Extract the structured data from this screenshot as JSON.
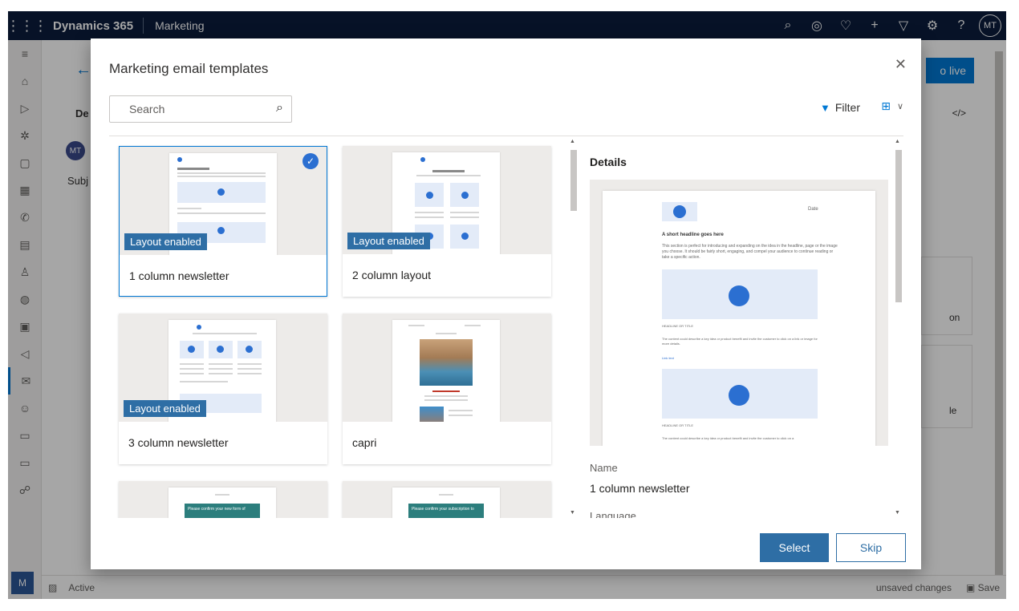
{
  "topbar": {
    "brand": "Dynamics 365",
    "app": "Marketing",
    "avatar": "MT",
    "icons": [
      "search-icon",
      "target-icon",
      "lightbulb-icon",
      "plus-icon",
      "filter-icon",
      "gear-icon",
      "help-icon"
    ]
  },
  "background": {
    "go_live": "o live",
    "tab": "De",
    "code": "</>",
    "avatar": "MT",
    "subject": "Subj",
    "card1_text": "on",
    "card2_text": "le",
    "status": "Active",
    "unsaved": "unsaved changes",
    "save": "Save",
    "rail_bottom": "M"
  },
  "dialog": {
    "title": "Marketing email templates",
    "search_placeholder": "Search",
    "filter_label": "Filter",
    "templates": [
      {
        "label": "1 column newsletter",
        "badge": "Layout enabled",
        "selected": true
      },
      {
        "label": "2 column layout",
        "badge": "Layout enabled",
        "selected": false
      },
      {
        "label": "3 column newsletter",
        "badge": "Layout enabled",
        "selected": false
      },
      {
        "label": "capri",
        "badge": "",
        "selected": false
      },
      {
        "label": "",
        "badge": "",
        "selected": false
      },
      {
        "label": "",
        "badge": "",
        "selected": false
      }
    ],
    "thumb_text": {
      "confirm_a": "Please confirm your new form of",
      "confirm_b": "Please confirm your subscription to"
    },
    "details": {
      "title": "Details",
      "preview_date": "Date",
      "preview_headline": "A short headline goes here",
      "preview_body": "This section is perfect for introducing and expanding on the idea in the headline, page or the image you choose. It should be fairly short, engaging, and compel your audience to continue reading or take a specific action.",
      "preview_headline2": "HEADLINE OR TITLE",
      "preview_body2": "The content could describe a key idea or product benefit and invite the customer to click on a link or image for more details.",
      "preview_link": "Link text",
      "preview_body3": "The content could describe a key idea or product benefit and invite the customer to click on a",
      "name_label": "Name",
      "name_value": "1 column newsletter",
      "language_label": "Language"
    },
    "buttons": {
      "select": "Select",
      "skip": "Skip"
    }
  }
}
